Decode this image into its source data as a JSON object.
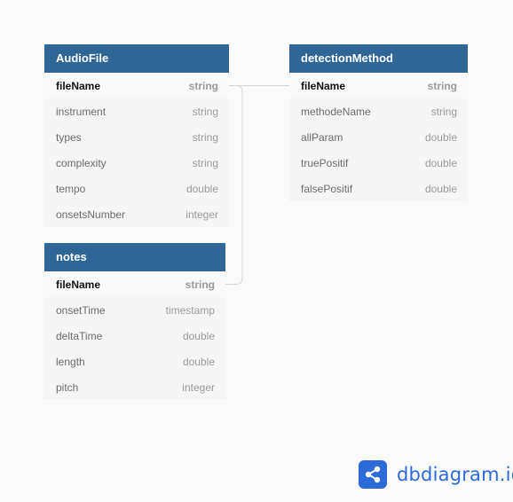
{
  "diagram": {
    "tables": [
      {
        "name": "AudioFile",
        "fields": [
          {
            "name": "fileName",
            "type": "string",
            "key": true
          },
          {
            "name": "instrument",
            "type": "string",
            "key": false
          },
          {
            "name": "types",
            "type": "string",
            "key": false
          },
          {
            "name": "complexity",
            "type": "string",
            "key": false
          },
          {
            "name": "tempo",
            "type": "double",
            "key": false
          },
          {
            "name": "onsetsNumber",
            "type": "integer",
            "key": false
          }
        ]
      },
      {
        "name": "detectionMethod",
        "fields": [
          {
            "name": "fileName",
            "type": "string",
            "key": true
          },
          {
            "name": "methodeName",
            "type": "string",
            "key": false
          },
          {
            "name": "allParam",
            "type": "double",
            "key": false
          },
          {
            "name": "truePositif",
            "type": "double",
            "key": false
          },
          {
            "name": "falsePositif",
            "type": "double",
            "key": false
          }
        ]
      },
      {
        "name": "notes",
        "fields": [
          {
            "name": "fileName",
            "type": "string",
            "key": true
          },
          {
            "name": "onsetTime",
            "type": "timestamp",
            "key": false
          },
          {
            "name": "deltaTime",
            "type": "double",
            "key": false
          },
          {
            "name": "length",
            "type": "double",
            "key": false
          },
          {
            "name": "pitch",
            "type": "integer",
            "key": false
          }
        ]
      }
    ],
    "relations": [
      {
        "from": "AudioFile.fileName",
        "to": "detectionMethod.fileName"
      },
      {
        "from": "AudioFile.fileName",
        "to": "notes.fileName"
      }
    ]
  },
  "colors": {
    "header": "#2e6796",
    "brand": "#2c6ad8",
    "connector": "#d6d6d6"
  },
  "brand": {
    "text": "dbdiagram.io",
    "icon": "share-nodes-icon"
  }
}
